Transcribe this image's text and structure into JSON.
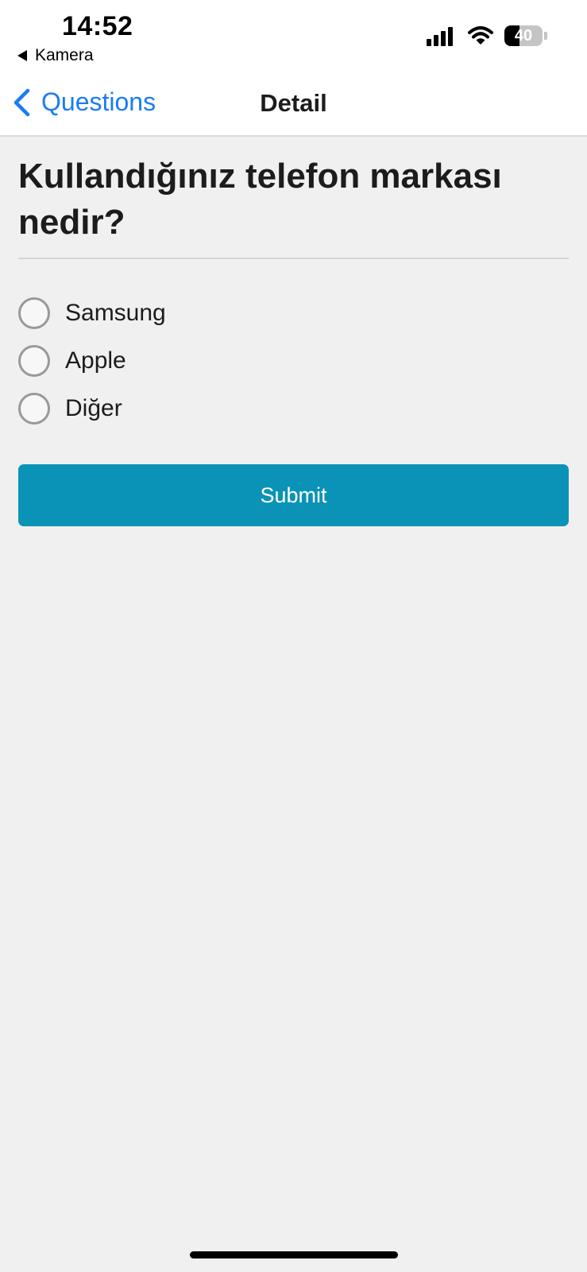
{
  "status_bar": {
    "time": "14:52",
    "back_app": "Kamera",
    "battery_text": "40",
    "battery_level": 0.4,
    "icons": [
      "back-triangle-icon",
      "cellular-signal-icon",
      "wifi-icon",
      "battery-icon"
    ]
  },
  "nav": {
    "back_label": "Questions",
    "title": "Detail",
    "back_icon": "chevron-left-icon"
  },
  "question": {
    "text": "Kullandığınız telefon markası nedir?",
    "options": [
      {
        "label": "Samsung",
        "selected": false
      },
      {
        "label": "Apple",
        "selected": false
      },
      {
        "label": "Diğer",
        "selected": false
      }
    ]
  },
  "submit": {
    "label": "Submit"
  },
  "colors": {
    "accent": "#1a7cf2",
    "submit_bg": "#0a93b6",
    "background": "#f0f0f0",
    "radio_border": "#999999"
  }
}
